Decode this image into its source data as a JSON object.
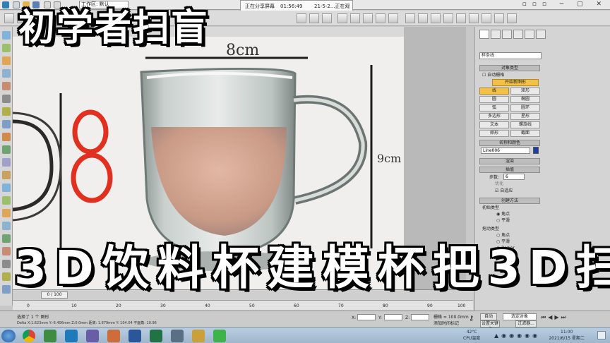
{
  "window": {
    "workspace_label": "工作区: 默认",
    "share_status": "正在分享屏幕",
    "share_timer": "01:56:49",
    "share_info": "21-5-2...正在观看"
  },
  "overlay": {
    "title_top": "初学者扫盲",
    "title_bottom": "3D饮料杯建模杯把3D扫"
  },
  "viewport_image": {
    "dimension_top": "8cm",
    "dimension_right": "9cm",
    "digit_label": "8"
  },
  "command_panel": {
    "category": "样条线",
    "rollout_object_type": "对象类型",
    "autogrid_label": "自动栅格",
    "start_new_shape": "开始新图形",
    "shape_buttons": [
      "线",
      "矩形",
      "圆",
      "椭圆",
      "弧",
      "圆环",
      "多边形",
      "星形",
      "文本",
      "螺旋线",
      "卵形",
      "截面"
    ],
    "rollout_name_color": "名称和颜色",
    "object_name": "Line006",
    "rollout_render": "渲染",
    "rollout_interp": "插值",
    "steps_label": "步数:",
    "steps_value": "6",
    "optimize_label": "优化",
    "adaptive_label": "自适应",
    "rollout_create_method": "创建方法",
    "initial_type_label": "初始类型",
    "corner_label": "角点",
    "smooth_label": "平滑",
    "drag_type_label": "拖动类型",
    "drag_corner": "角点",
    "drag_smooth": "平滑",
    "drag_bezier": "Bezier",
    "accent_color": "#f3c146"
  },
  "timeline": {
    "slider_label": "0 / 100",
    "ruler_ticks": [
      "0",
      "10",
      "20",
      "30",
      "40",
      "50",
      "60",
      "70",
      "80",
      "90",
      "100"
    ]
  },
  "statusbar": {
    "selection": "选择了 1 个 图形",
    "readout": "Delta X:1.623mm  Y:-6.406mm  Z:0.0mm  距离: 1.679mm  Y: 104.04  平面角: 10.96",
    "x_label": "X:",
    "y_label": "Y:",
    "z_label": "Z:",
    "grid": "栅格 = 100.0mm",
    "add_tag": "添加时间标记",
    "auto_key": "自动",
    "set_key": "设置关键点",
    "key_filter": "选定对象",
    "filter_btn": "过滤器..."
  },
  "taskbar": {
    "temp": "42°C",
    "cpu": "CPU温度",
    "time": "11:00",
    "date": "2021/6/15 星期二"
  }
}
